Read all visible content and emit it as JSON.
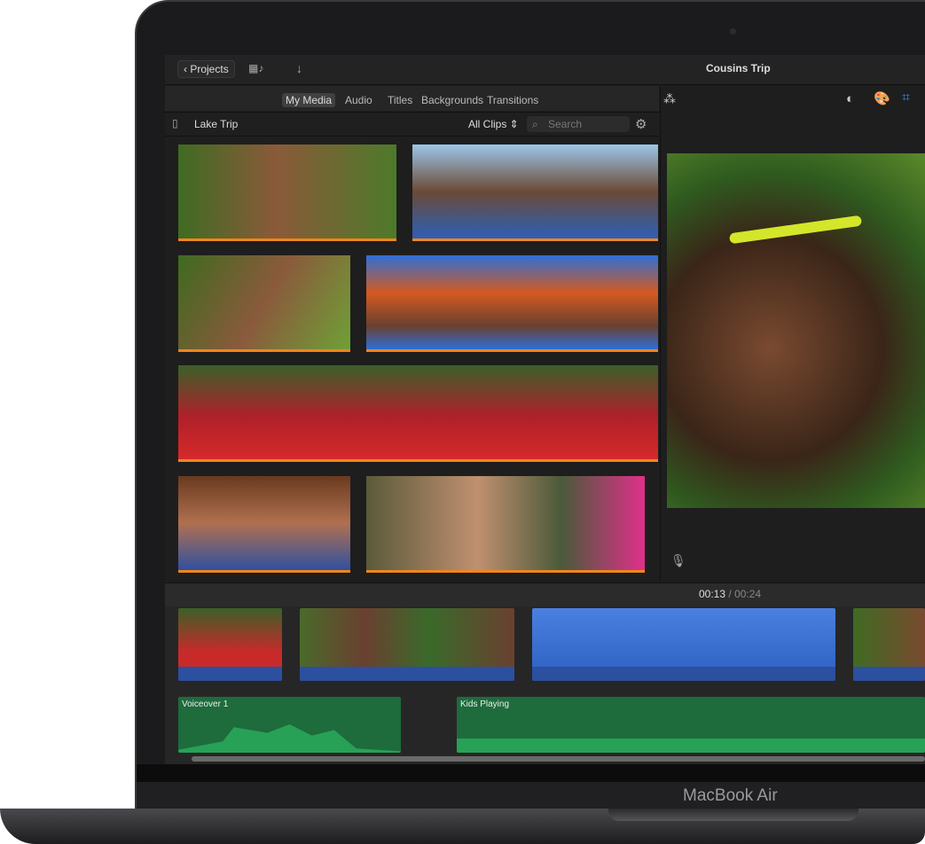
{
  "device": {
    "brand": "MacBook Air"
  },
  "toolbar": {
    "projects_label": "Projects",
    "project_title": "Cousins Trip"
  },
  "browser": {
    "tabs": [
      {
        "label": "My Media",
        "active": true
      },
      {
        "label": "Audio"
      },
      {
        "label": "Titles"
      },
      {
        "label": "Backgrounds"
      },
      {
        "label": "Transitions"
      }
    ],
    "library": "Lake Trip",
    "filter": "All Clips",
    "search": {
      "placeholder": "Search",
      "value": ""
    }
  },
  "viewer": {
    "tools": [
      "magic-wand-icon",
      "color-balance-icon",
      "color-palette-icon",
      "crop-icon"
    ],
    "accent": "#3b82f6"
  },
  "timeline": {
    "current": "00:13",
    "separator": "/",
    "total": "00:24",
    "audio_clips": [
      {
        "label": "Voiceover 1"
      },
      {
        "label": "Kids Playing"
      }
    ]
  },
  "colors": {
    "selection": "#f0861b",
    "audio": "#1e6b3c",
    "waveform": "#2c4fa0"
  }
}
